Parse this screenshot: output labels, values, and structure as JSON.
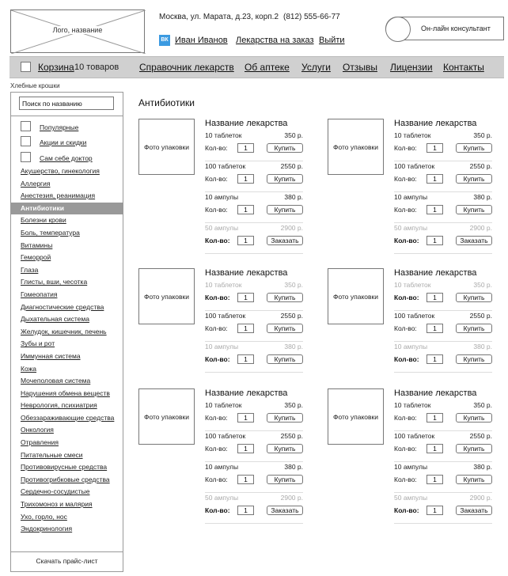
{
  "header": {
    "logo_label": "Лого, название",
    "address": "Москва, ул. Марата, д.23, корп.2",
    "phone": "(812) 555-66-77",
    "vk_label": "ВК",
    "user_name": "Иван Иванов",
    "order_link": "Лекарства на заказ",
    "logout_link": "Выйти",
    "consultant": "Он-лайн консультант"
  },
  "nav": {
    "cart_label": "Корзина",
    "cart_count": "10 товаров",
    "links": [
      "Справочник лекарств",
      "Об аптеке",
      "Услуги",
      "Отзывы",
      "Лицензии",
      "Контакты"
    ]
  },
  "breadcrumbs": "Хлебные крошки",
  "sidebar": {
    "search_placeholder": "Поиск по названию",
    "quick": [
      "Популярные",
      "Акции и скидки",
      "Сам себе доктор"
    ],
    "categories": [
      "Акушерство, гинекология",
      "Аллергия",
      "Анестезия, реанимация",
      "Антибиотики",
      "Болезни крови",
      "Боль, температура",
      "Витамины",
      "Геморрой",
      "Глаза",
      "Глисты, вши, чесотка",
      "Гомеопатия",
      "Диагностические средства",
      "Дыхательная система",
      "Желудок, кишечник, печень",
      "Зубы и рот",
      "Иммунная система",
      "Кожа",
      "Мочеполовая система",
      "Нарушения обмена веществ",
      "Неврология, психиатрия",
      "Обеззараживающие средства",
      "Онкология",
      "Отравления",
      "Питательные смеси",
      "Противовирусные средства",
      "Противогрибковые средства",
      "Сердечно-сосудистые",
      "Трихомоноз и малярия",
      "Ухо, горло, нос",
      "Эндокринология"
    ],
    "active_category": "Антибиотики",
    "price_list": "Скачать прайс-лист"
  },
  "main": {
    "title": "Антибиотики",
    "photo_label": "Фото упаковки",
    "product_name": "Название лекарства",
    "qty_label": "Кол-во:",
    "products": [
      {
        "variants": [
          {
            "name": "10 таблеток",
            "price": "350 р.",
            "qty": "1",
            "button": "Купить",
            "available": true
          },
          {
            "name": "100 таблеток",
            "price": "2550 р.",
            "qty": "1",
            "button": "Купить",
            "available": true
          },
          {
            "name": "10 ампулы",
            "price": "380 р.",
            "qty": "1",
            "button": "Купить",
            "available": true
          },
          {
            "name": "50 ампулы",
            "price": "2900 р.",
            "qty": "1",
            "button": "Заказать",
            "available": false
          }
        ]
      },
      {
        "variants": [
          {
            "name": "10 таблеток",
            "price": "350 р.",
            "qty": "1",
            "button": "Купить",
            "available": true
          },
          {
            "name": "100 таблеток",
            "price": "2550 р.",
            "qty": "1",
            "button": "Купить",
            "available": true
          },
          {
            "name": "10 ампулы",
            "price": "380 р.",
            "qty": "1",
            "button": "Купить",
            "available": true
          },
          {
            "name": "50 ампулы",
            "price": "2900 р.",
            "qty": "1",
            "button": "Заказать",
            "available": false
          }
        ]
      },
      {
        "variants": [
          {
            "name": "10 таблеток",
            "price": "350 р.",
            "qty": "1",
            "button": "Купить",
            "available": false
          },
          {
            "name": "100 таблеток",
            "price": "2550 р.",
            "qty": "1",
            "button": "Купить",
            "available": true
          },
          {
            "name": "10 ампулы",
            "price": "380 р.",
            "qty": "1",
            "button": "Купить",
            "available": false
          }
        ]
      },
      {
        "variants": [
          {
            "name": "10 таблеток",
            "price": "350 р.",
            "qty": "1",
            "button": "Купить",
            "available": false
          },
          {
            "name": "100 таблеток",
            "price": "2550 р.",
            "qty": "1",
            "button": "Купить",
            "available": true
          },
          {
            "name": "10 ампулы",
            "price": "380 р.",
            "qty": "1",
            "button": "Купить",
            "available": false
          }
        ]
      },
      {
        "variants": [
          {
            "name": "10 таблеток",
            "price": "350 р.",
            "qty": "1",
            "button": "Купить",
            "available": true
          },
          {
            "name": "100 таблеток",
            "price": "2550 р.",
            "qty": "1",
            "button": "Купить",
            "available": true
          },
          {
            "name": "10 ампулы",
            "price": "380 р.",
            "qty": "1",
            "button": "Купить",
            "available": true
          },
          {
            "name": "50 ампулы",
            "price": "2900 р.",
            "qty": "1",
            "button": "Заказать",
            "available": false
          }
        ]
      },
      {
        "variants": [
          {
            "name": "10 таблеток",
            "price": "350 р.",
            "qty": "1",
            "button": "Купить",
            "available": true
          },
          {
            "name": "100 таблеток",
            "price": "2550 р.",
            "qty": "1",
            "button": "Купить",
            "available": true
          },
          {
            "name": "10 ампулы",
            "price": "380 р.",
            "qty": "1",
            "button": "Купить",
            "available": true
          },
          {
            "name": "50 ампулы",
            "price": "2900 р.",
            "qty": "1",
            "button": "Заказать",
            "available": false
          }
        ]
      }
    ]
  }
}
